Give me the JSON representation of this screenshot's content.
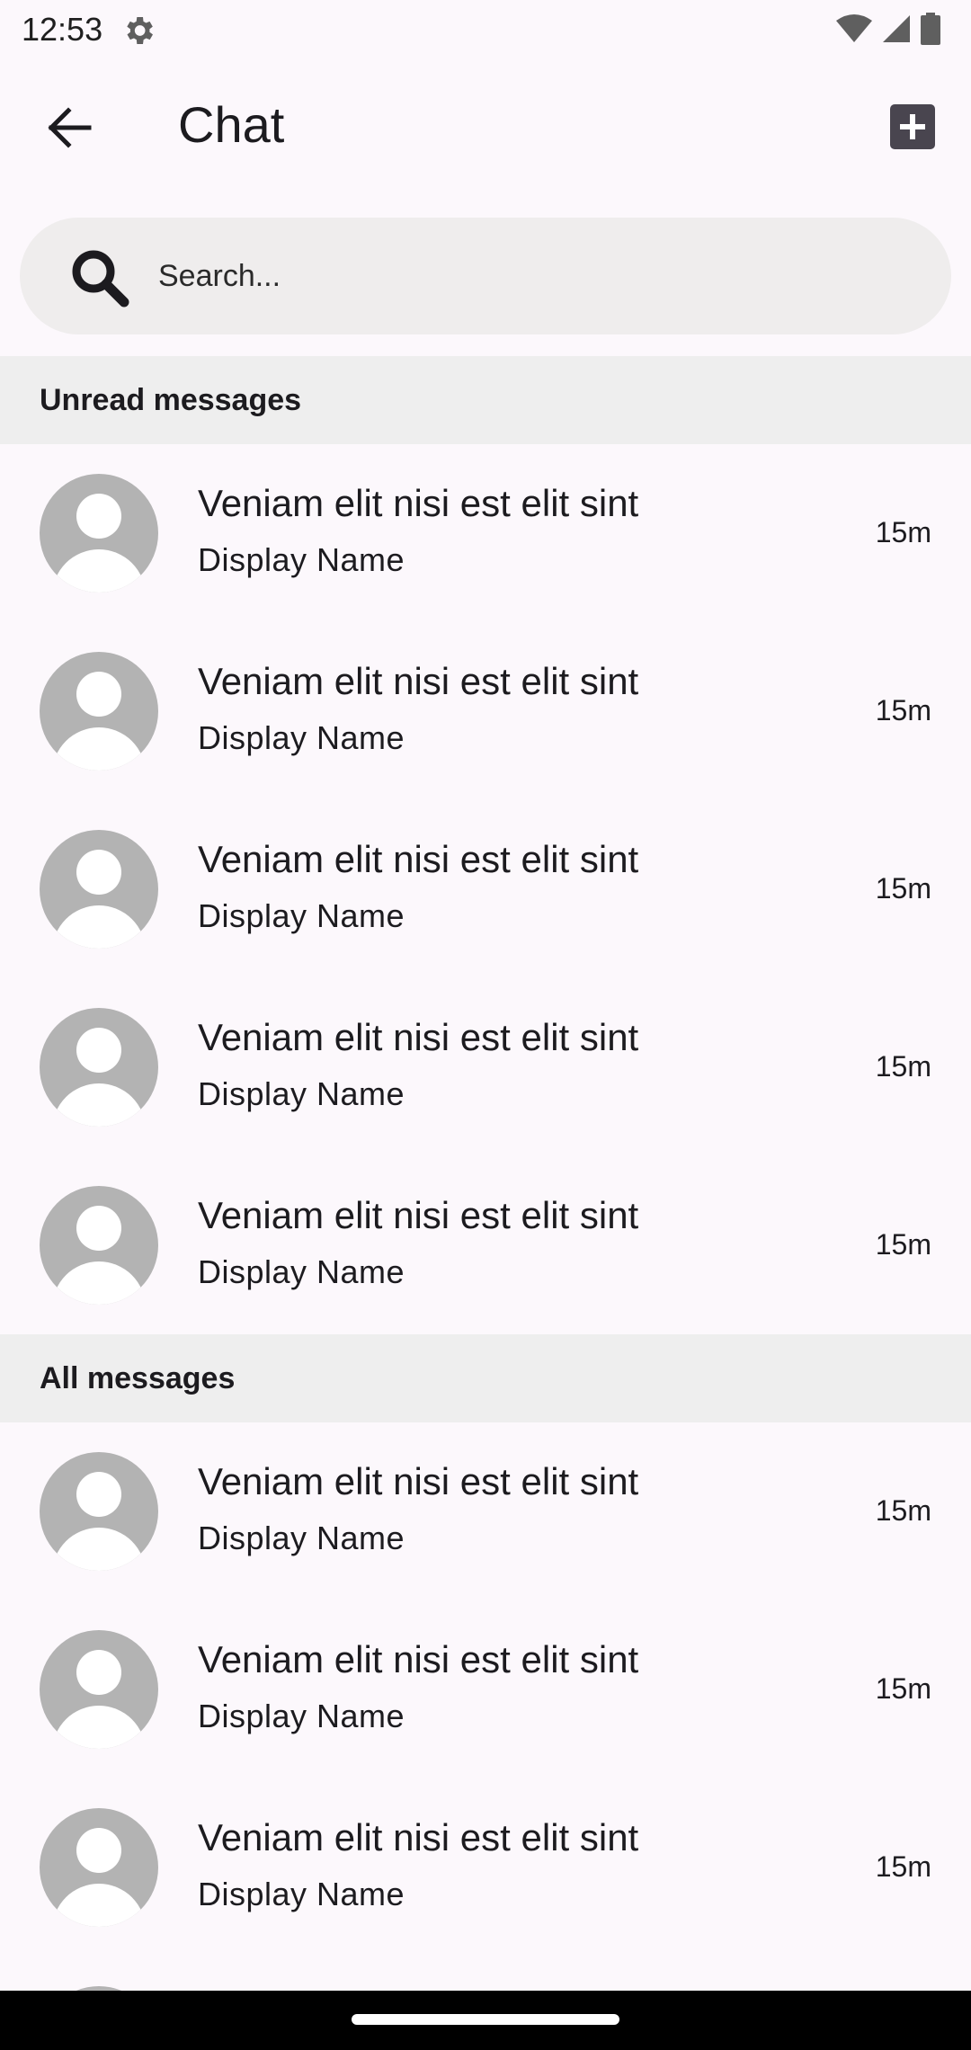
{
  "status_bar": {
    "time": "12:53",
    "icons": [
      "gear-icon",
      "wifi-icon",
      "signal-icon",
      "battery-icon"
    ]
  },
  "app_bar": {
    "title": "Chat",
    "back_icon": "arrow-back-icon",
    "add_icon": "add-box-icon"
  },
  "search": {
    "placeholder": "Search...",
    "icon": "search-icon"
  },
  "sections": {
    "unread": {
      "label": "Unread messages",
      "items": [
        {
          "title": "Veniam elit nisi est elit sint",
          "subtitle": "Display Name",
          "time": "15m"
        },
        {
          "title": "Veniam elit nisi est elit sint",
          "subtitle": "Display Name",
          "time": "15m"
        },
        {
          "title": "Veniam elit nisi est elit sint",
          "subtitle": "Display Name",
          "time": "15m"
        },
        {
          "title": "Veniam elit nisi est elit sint",
          "subtitle": "Display Name",
          "time": "15m"
        },
        {
          "title": "Veniam elit nisi est elit sint",
          "subtitle": "Display Name",
          "time": "15m"
        }
      ]
    },
    "all": {
      "label": "All messages",
      "items": [
        {
          "title": "Veniam elit nisi est elit sint",
          "subtitle": "Display Name",
          "time": "15m"
        },
        {
          "title": "Veniam elit nisi est elit sint",
          "subtitle": "Display Name",
          "time": "15m"
        },
        {
          "title": "Veniam elit nisi est elit sint",
          "subtitle": "Display Name",
          "time": "15m"
        }
      ]
    }
  },
  "colors": {
    "background": "#fcf8fc",
    "section_header": "#eeeeee",
    "search_background": "#efeded",
    "avatar": "#b3b3b3",
    "nav_bar": "#000000"
  }
}
